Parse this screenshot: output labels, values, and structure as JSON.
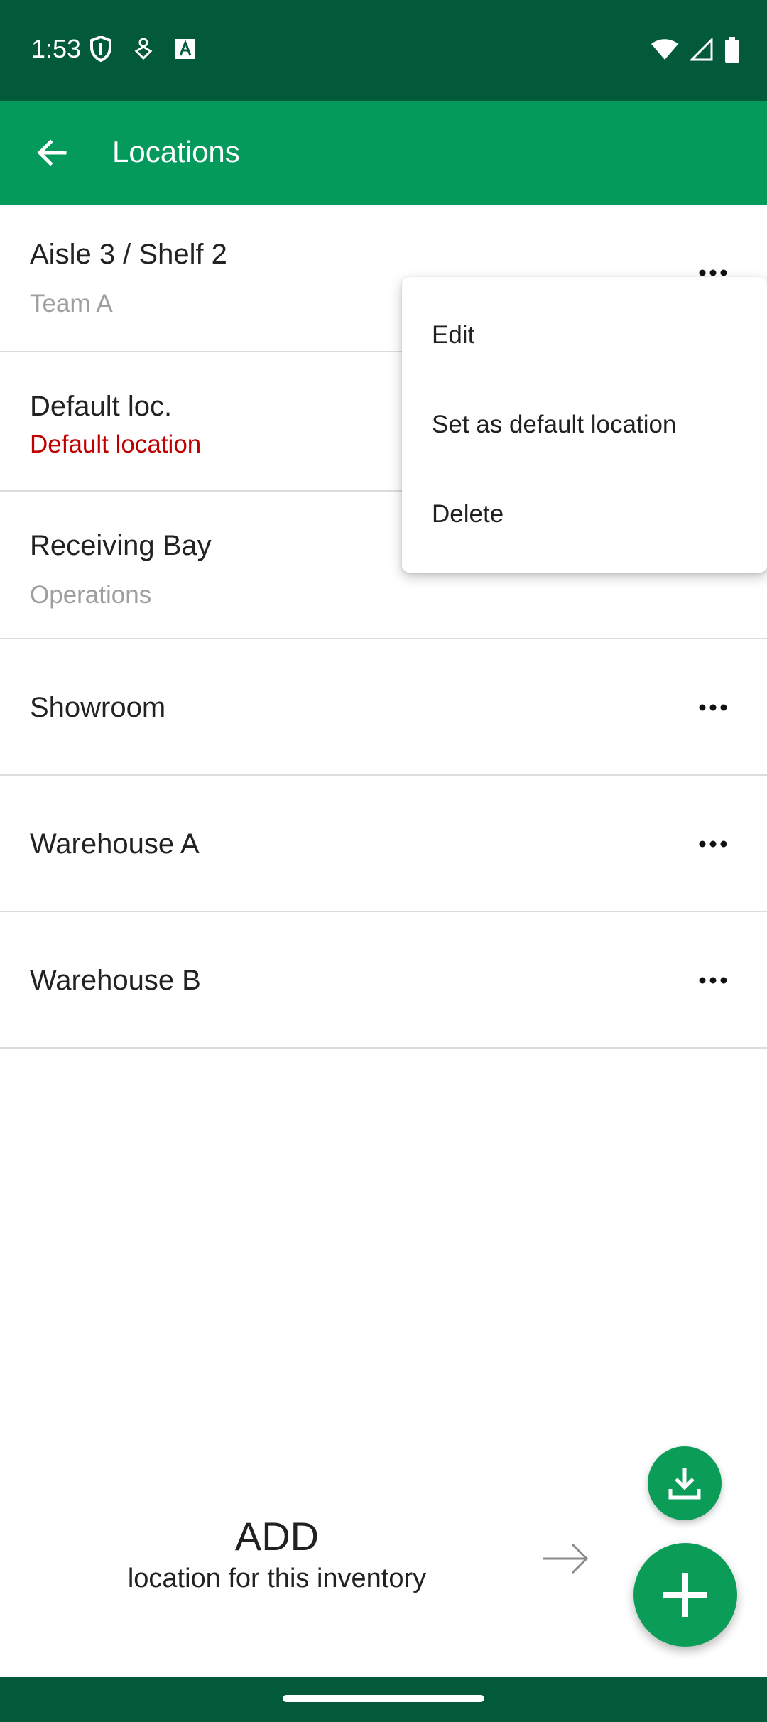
{
  "status_bar": {
    "time": "1:53",
    "left_icons": [
      "shield-icon",
      "hand-coin-icon",
      "text-a-icon"
    ],
    "right_icons": [
      "wifi-icon",
      "cell-signal-icon",
      "battery-icon"
    ],
    "background": "#035a3b"
  },
  "app_bar": {
    "title": "Locations",
    "back_icon": "arrow-left-icon",
    "background": "#039a5b"
  },
  "locations": [
    {
      "name": "Aisle 3 / Shelf 2",
      "subtitle": "Team A"
    },
    {
      "name": "Default loc.",
      "subtitle": "Default location"
    },
    {
      "name": "Receiving Bay",
      "subtitle": "Operations"
    },
    {
      "name": "Showroom",
      "subtitle": ""
    },
    {
      "name": "Warehouse A",
      "subtitle": ""
    },
    {
      "name": "Warehouse B",
      "subtitle": ""
    }
  ],
  "context_menu": {
    "items": [
      "Edit",
      "Set as default location",
      "Delete"
    ]
  },
  "add_hint": {
    "title": "ADD",
    "subtitle": "location for this inventory"
  },
  "fab": {
    "small_icon": "download-icon",
    "large_icon": "plus-icon",
    "color": "#0b9c58"
  },
  "colors": {
    "accent": "#039a5b",
    "default_location_text": "#c00000",
    "subtitle_gray": "#9e9e9e"
  }
}
